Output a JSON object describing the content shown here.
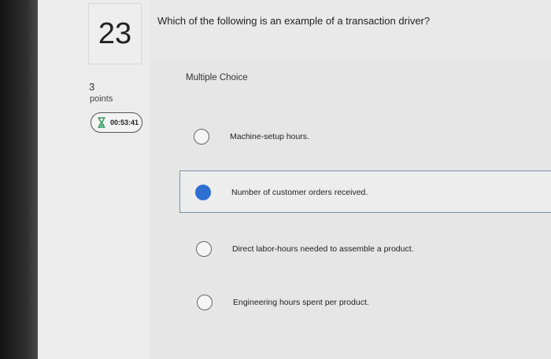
{
  "question": {
    "number": "23",
    "points_value": "3",
    "points_label": "points",
    "timer": "00:53:41",
    "text": "Which of the following is an example of a transaction driver?",
    "type_label": "Multiple Choice"
  },
  "options": [
    {
      "label": "Machine-setup hours.",
      "selected": false
    },
    {
      "label": "Number of customer orders received.",
      "selected": true
    },
    {
      "label": "Direct labor-hours needed to assemble a product.",
      "selected": false
    },
    {
      "label": "Engineering hours spent per product.",
      "selected": false
    }
  ],
  "colors": {
    "selected_radio": "#2f6fd0",
    "timer_icon": "#2e9c5a"
  },
  "icons": {
    "timer": "hourglass-icon"
  }
}
